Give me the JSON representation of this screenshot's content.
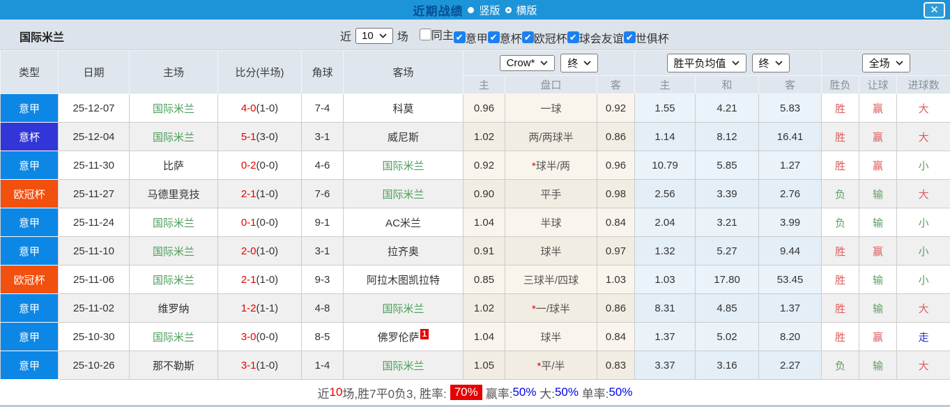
{
  "colors": {
    "topbar": "#1d94d8",
    "title_text": "#084f93",
    "badge_serie_a": "#0d87e6",
    "badge_coppa_italia": "#3236d6",
    "badge_champions_league": "#f2500f",
    "team_green": "#4a9e58",
    "score_red": "#e60000",
    "result_red": "#e05c5c",
    "result_green": "#5f9e63",
    "result_blue": "#2b2bd5",
    "footer_rate_badge": "#e60000",
    "footer_blue": "#0000ee",
    "handicap_col_bg": "#faf5ec",
    "odds_col_bg": "#eaf3fa"
  },
  "titlebar": {
    "title": "近期战绩",
    "radio_vertical_label": "竖版",
    "radio_vertical_selected": true,
    "radio_horizontal_label": "横版",
    "radio_horizontal_selected": false,
    "close_label": "✕"
  },
  "filters": {
    "team": "国际米兰",
    "recent_label": "近",
    "recent_value": "10",
    "matches_label": "场",
    "checkboxes": [
      {
        "label": "同主",
        "checked": false,
        "label_first": true
      },
      {
        "label": "意甲",
        "checked": true,
        "label_first": false
      },
      {
        "label": "意杯",
        "checked": true,
        "label_first": false
      },
      {
        "label": "欧冠杯",
        "checked": true,
        "label_first": false
      },
      {
        "label": "球会友谊",
        "checked": true,
        "label_first": false
      },
      {
        "label": "世俱杯",
        "checked": true,
        "label_first": false
      }
    ]
  },
  "controls": {
    "company": "Crow*",
    "company_time": "终",
    "avg": "胜平负均值",
    "avg_time": "终",
    "scope": "全场"
  },
  "table": {
    "columns": [
      "类型",
      "日期",
      "主场",
      "比分(半场)",
      "角球",
      "客场"
    ],
    "subheaders": [
      "主",
      "盘口",
      "客",
      "主",
      "和",
      "客",
      "胜负",
      "让球",
      "进球数"
    ],
    "rows": [
      {
        "type": {
          "label": "意甲",
          "color": "#0d87e6"
        },
        "date": "25-12-07",
        "home": {
          "name": "国际米兰",
          "team": true
        },
        "score": "4-0",
        "half": "(1-0)",
        "corner": "7-4",
        "away": {
          "name": "科莫",
          "team": false,
          "badge": null
        },
        "crow": {
          "home": "0.96",
          "pan": "一球",
          "star": false,
          "away": "0.92"
        },
        "odds": {
          "home": "1.55",
          "draw": "4.21",
          "away": "5.83"
        },
        "res": {
          "wl": {
            "t": "胜",
            "c": "r"
          },
          "rq": {
            "t": "赢",
            "c": "r"
          },
          "jq": {
            "t": "大",
            "c": "r"
          }
        }
      },
      {
        "type": {
          "label": "意杯",
          "color": "#3236d6"
        },
        "date": "25-12-04",
        "home": {
          "name": "国际米兰",
          "team": true
        },
        "score": "5-1",
        "half": "(3-0)",
        "corner": "3-1",
        "away": {
          "name": "威尼斯",
          "team": false,
          "badge": null
        },
        "crow": {
          "home": "1.02",
          "pan": "两/两球半",
          "star": false,
          "away": "0.86"
        },
        "odds": {
          "home": "1.14",
          "draw": "8.12",
          "away": "16.41"
        },
        "res": {
          "wl": {
            "t": "胜",
            "c": "r"
          },
          "rq": {
            "t": "赢",
            "c": "r"
          },
          "jq": {
            "t": "大",
            "c": "r"
          }
        }
      },
      {
        "type": {
          "label": "意甲",
          "color": "#0d87e6"
        },
        "date": "25-11-30",
        "home": {
          "name": "比萨",
          "team": false
        },
        "score": "0-2",
        "half": "(0-0)",
        "corner": "4-6",
        "away": {
          "name": "国际米兰",
          "team": true,
          "badge": null
        },
        "crow": {
          "home": "0.92",
          "pan": "球半/两",
          "star": true,
          "away": "0.96"
        },
        "odds": {
          "home": "10.79",
          "draw": "5.85",
          "away": "1.27"
        },
        "res": {
          "wl": {
            "t": "胜",
            "c": "r"
          },
          "rq": {
            "t": "赢",
            "c": "r"
          },
          "jq": {
            "t": "小",
            "c": "g"
          }
        }
      },
      {
        "type": {
          "label": "欧冠杯",
          "color": "#f2500f"
        },
        "date": "25-11-27",
        "home": {
          "name": "马德里竞技",
          "team": false
        },
        "score": "2-1",
        "half": "(1-0)",
        "corner": "7-6",
        "away": {
          "name": "国际米兰",
          "team": true,
          "badge": null
        },
        "crow": {
          "home": "0.90",
          "pan": "平手",
          "star": false,
          "away": "0.98"
        },
        "odds": {
          "home": "2.56",
          "draw": "3.39",
          "away": "2.76"
        },
        "res": {
          "wl": {
            "t": "负",
            "c": "g"
          },
          "rq": {
            "t": "输",
            "c": "g"
          },
          "jq": {
            "t": "大",
            "c": "r"
          }
        }
      },
      {
        "type": {
          "label": "意甲",
          "color": "#0d87e6"
        },
        "date": "25-11-24",
        "home": {
          "name": "国际米兰",
          "team": true
        },
        "score": "0-1",
        "half": "(0-0)",
        "corner": "9-1",
        "away": {
          "name": "AC米兰",
          "team": false,
          "badge": null
        },
        "crow": {
          "home": "1.04",
          "pan": "半球",
          "star": false,
          "away": "0.84"
        },
        "odds": {
          "home": "2.04",
          "draw": "3.21",
          "away": "3.99"
        },
        "res": {
          "wl": {
            "t": "负",
            "c": "g"
          },
          "rq": {
            "t": "输",
            "c": "g"
          },
          "jq": {
            "t": "小",
            "c": "g"
          }
        }
      },
      {
        "type": {
          "label": "意甲",
          "color": "#0d87e6"
        },
        "date": "25-11-10",
        "home": {
          "name": "国际米兰",
          "team": true
        },
        "score": "2-0",
        "half": "(1-0)",
        "corner": "3-1",
        "away": {
          "name": "拉齐奥",
          "team": false,
          "badge": null
        },
        "crow": {
          "home": "0.91",
          "pan": "球半",
          "star": false,
          "away": "0.97"
        },
        "odds": {
          "home": "1.32",
          "draw": "5.27",
          "away": "9.44"
        },
        "res": {
          "wl": {
            "t": "胜",
            "c": "r"
          },
          "rq": {
            "t": "赢",
            "c": "r"
          },
          "jq": {
            "t": "小",
            "c": "g"
          }
        }
      },
      {
        "type": {
          "label": "欧冠杯",
          "color": "#f2500f"
        },
        "date": "25-11-06",
        "home": {
          "name": "国际米兰",
          "team": true
        },
        "score": "2-1",
        "half": "(1-0)",
        "corner": "9-3",
        "away": {
          "name": "阿拉木图凯拉特",
          "team": false,
          "badge": null
        },
        "crow": {
          "home": "0.85",
          "pan": "三球半/四球",
          "star": false,
          "away": "1.03"
        },
        "odds": {
          "home": "1.03",
          "draw": "17.80",
          "away": "53.45"
        },
        "res": {
          "wl": {
            "t": "胜",
            "c": "r"
          },
          "rq": {
            "t": "输",
            "c": "g"
          },
          "jq": {
            "t": "小",
            "c": "g"
          }
        }
      },
      {
        "type": {
          "label": "意甲",
          "color": "#0d87e6"
        },
        "date": "25-11-02",
        "home": {
          "name": "维罗纳",
          "team": false
        },
        "score": "1-2",
        "half": "(1-1)",
        "corner": "4-8",
        "away": {
          "name": "国际米兰",
          "team": true,
          "badge": null
        },
        "crow": {
          "home": "1.02",
          "pan": "一/球半",
          "star": true,
          "away": "0.86"
        },
        "odds": {
          "home": "8.31",
          "draw": "4.85",
          "away": "1.37"
        },
        "res": {
          "wl": {
            "t": "胜",
            "c": "r"
          },
          "rq": {
            "t": "输",
            "c": "g"
          },
          "jq": {
            "t": "大",
            "c": "r"
          }
        }
      },
      {
        "type": {
          "label": "意甲",
          "color": "#0d87e6"
        },
        "date": "25-10-30",
        "home": {
          "name": "国际米兰",
          "team": true
        },
        "score": "3-0",
        "half": "(0-0)",
        "corner": "8-5",
        "away": {
          "name": "佛罗伦萨",
          "team": false,
          "badge": "1"
        },
        "crow": {
          "home": "1.04",
          "pan": "球半",
          "star": false,
          "away": "0.84"
        },
        "odds": {
          "home": "1.37",
          "draw": "5.02",
          "away": "8.20"
        },
        "res": {
          "wl": {
            "t": "胜",
            "c": "r"
          },
          "rq": {
            "t": "赢",
            "c": "r"
          },
          "jq": {
            "t": "走",
            "c": "b"
          }
        }
      },
      {
        "type": {
          "label": "意甲",
          "color": "#0d87e6"
        },
        "date": "25-10-26",
        "home": {
          "name": "那不勒斯",
          "team": false
        },
        "score": "3-1",
        "half": "(1-0)",
        "corner": "1-4",
        "away": {
          "name": "国际米兰",
          "team": true,
          "badge": null
        },
        "crow": {
          "home": "1.05",
          "pan": "平/半",
          "star": true,
          "away": "0.83"
        },
        "odds": {
          "home": "3.37",
          "draw": "3.16",
          "away": "2.27"
        },
        "res": {
          "wl": {
            "t": "负",
            "c": "g"
          },
          "rq": {
            "t": "输",
            "c": "g"
          },
          "jq": {
            "t": "大",
            "c": "r"
          }
        }
      }
    ]
  },
  "footer": {
    "segments": [
      {
        "text": "近",
        "style": "plain"
      },
      {
        "text": "10",
        "style": "red"
      },
      {
        "text": "场,胜7平0负3, 胜率:",
        "style": "plain"
      },
      {
        "text": "70%",
        "style": "badge"
      },
      {
        "text": "赢率:",
        "style": "plain"
      },
      {
        "text": "50%",
        "style": "blue"
      },
      {
        "text": " 大:",
        "style": "plain"
      },
      {
        "text": "50%",
        "style": "blue"
      },
      {
        "text": " 单率:",
        "style": "plain"
      },
      {
        "text": "50%",
        "style": "blue"
      }
    ]
  }
}
